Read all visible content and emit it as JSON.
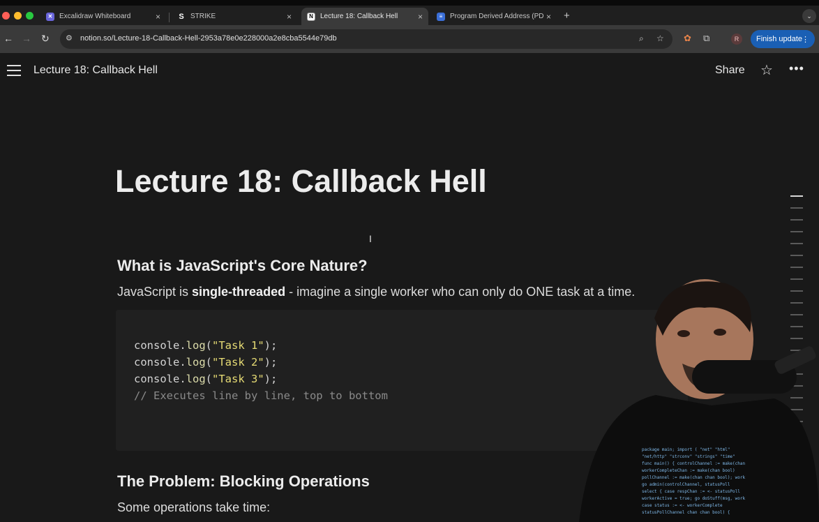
{
  "browser": {
    "tabs": [
      {
        "title": "Excalidraw Whiteboard",
        "icon": "excalidraw-icon",
        "active": false
      },
      {
        "title": "STRIKE",
        "icon": "strike-icon",
        "active": false
      },
      {
        "title": "Lecture 18: Callback Hell",
        "icon": "notion-icon",
        "active": true
      },
      {
        "title": "Program Derived Address (PD",
        "icon": "docs-icon",
        "active": false
      }
    ],
    "url": "notion.so/Lecture-18-Callback-Hell-2953a78e0e228000a2e8cba5544e79db",
    "profile_initial": "R",
    "finish_update_label": "Finish update"
  },
  "notion": {
    "breadcrumb": "Lecture 18: Callback Hell",
    "share_label": "Share"
  },
  "page": {
    "title": "Lecture 18: Callback Hell",
    "section1": {
      "heading": "What is JavaScript's Core Nature?",
      "para_prefix": "JavaScript is ",
      "para_bold": "single-threaded",
      "para_suffix": " - imagine a single worker who can only do ONE task at a time."
    },
    "code": {
      "lines": [
        {
          "obj": "console",
          "dot": ".",
          "fn": "log",
          "open": "(",
          "str": "\"Task 1\"",
          "close": ");"
        },
        {
          "obj": "console",
          "dot": ".",
          "fn": "log",
          "open": "(",
          "str": "\"Task 2\"",
          "close": ");"
        },
        {
          "obj": "console",
          "dot": ".",
          "fn": "log",
          "open": "(",
          "str": "\"Task 3\"",
          "close": ");"
        }
      ],
      "comment": "// Executes line by line, top to bottom"
    },
    "section2": {
      "heading": "The Problem: Blocking Operations",
      "para": "Some operations take time:"
    }
  },
  "colors": {
    "background": "#191919",
    "accent_blue": "#1a5fb4",
    "code_bg": "#202020"
  }
}
